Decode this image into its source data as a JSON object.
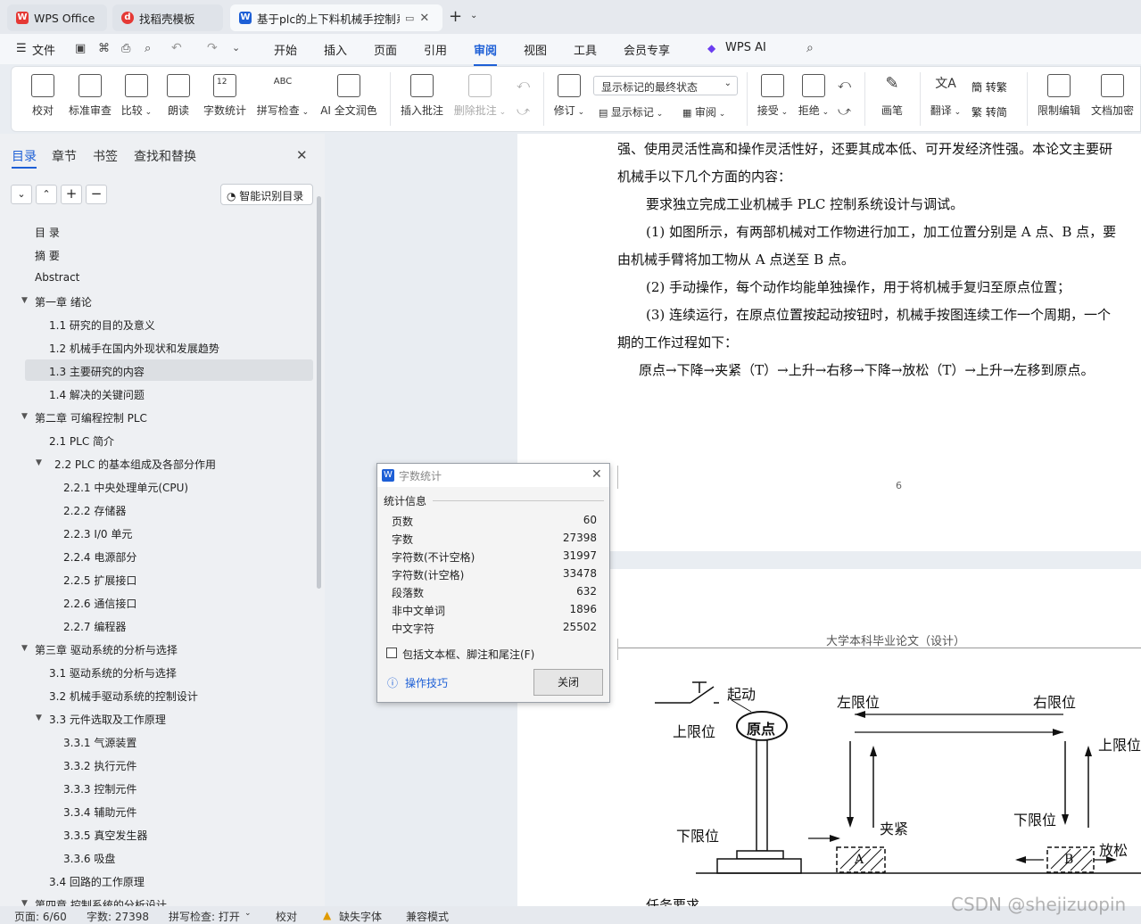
{
  "tabs": [
    {
      "label": "WPS Office"
    },
    {
      "label": "找稻壳模板"
    },
    {
      "label": "基于plc的上下料机械手控制系"
    }
  ],
  "menubar": {
    "file": "文件",
    "items": [
      "开始",
      "插入",
      "页面",
      "引用",
      "审阅",
      "视图",
      "工具",
      "会员专享"
    ],
    "ai": "WPS AI"
  },
  "ribbon": {
    "proofread": "校对",
    "standard_review": "标准审查",
    "compare": "比较",
    "read_aloud": "朗读",
    "word_count": "字数统计",
    "spell_check": "拼写检查",
    "ai_polish": "AI 全文润色",
    "insert_comment": "插入批注",
    "delete_comment": "删除批注",
    "track": "修订",
    "markup_select": "显示标记的最终状态",
    "show_markup": "显示标记",
    "review": "审阅",
    "accept": "接受",
    "reject": "拒绝",
    "pen": "画笔",
    "translate": "翻译",
    "to_trad": "转繁",
    "to_simp": "转简",
    "restrict": "限制编辑",
    "encrypt": "文档加密"
  },
  "sidebar": {
    "tabs": [
      "目录",
      "章节",
      "书签",
      "查找和替换"
    ],
    "smart_toc": "智能识别目录",
    "toc": [
      {
        "label": "目    录"
      },
      {
        "label": "摘    要"
      },
      {
        "label": "Abstract"
      },
      {
        "label": "第一章   绪论"
      },
      {
        "label": "1.1   研究的目的及意义"
      },
      {
        "label": "1.2   机械手在国内外现状和发展趋势"
      },
      {
        "label": "1.3   主要研究的内容"
      },
      {
        "label": "1.4   解决的关键问题"
      },
      {
        "label": "第二章  可编程控制 PLC"
      },
      {
        "label": "2.1 PLC  简介"
      },
      {
        "label": "2.2    PLC 的基本组成及各部分作用"
      },
      {
        "label": "2.2.1 中央处理单元(CPU)"
      },
      {
        "label": "2.2.2 存储器"
      },
      {
        "label": "2.2.3 I/0 单元"
      },
      {
        "label": "2.2.4 电源部分"
      },
      {
        "label": "2.2.5 扩展接口"
      },
      {
        "label": "2.2.6 通信接口"
      },
      {
        "label": "2.2.7 编程器"
      },
      {
        "label": "第三章   驱动系统的分析与选择"
      },
      {
        "label": "3.1   驱动系统的分析与选择"
      },
      {
        "label": "3.2   机械手驱动系统的控制设计"
      },
      {
        "label": "3.3   元件选取及工作原理"
      },
      {
        "label": "3.3.1    气源装置"
      },
      {
        "label": "3.3.2    执行元件"
      },
      {
        "label": "3.3.3    控制元件"
      },
      {
        "label": "3.3.4    辅助元件"
      },
      {
        "label": "3.3.5    真空发生器"
      },
      {
        "label": "3.3.6    吸盘"
      },
      {
        "label": "3.4   回路的工作原理"
      },
      {
        "label": "第四章   控制系统的分析设计"
      }
    ]
  },
  "document": {
    "lines": [
      "强、使用灵活性高和操作灵活性好，还要其成本低、可开发经济性强。本论文主要研",
      "机械手以下几个方面的内容：",
      "要求独立完成工业机械手 PLC 控制系统设计与调试。",
      "(1) 如图所示，有两部机械对工作物进行加工，加工位置分别是 A 点、B 点，要",
      "由机械手臂将加工物从 A 点送至 B 点。",
      "(2) 手动操作，每个动作均能单独操作，用于将机械手复归至原点位置；",
      "(3) 连续运行，在原点位置按起动按钮时，机械手按图连续工作一个周期，一个",
      "期的工作过程如下：",
      "原点→下降→夹紧（T）→上升→右移→下降→放松（T）→上升→左移到原点。"
    ],
    "page_number": "6",
    "header": "大学本科毕业论文（设计）",
    "diagram_labels": {
      "start": "起动",
      "origin": "原点",
      "upper_limit_left": "上限位",
      "lower_limit_left": "下限位",
      "left_limit": "左限位",
      "right_limit": "右限位",
      "clamp": "夹紧",
      "upper_limit_right": "上限位",
      "lower_limit_right": "下限位",
      "release": "放松",
      "a": "A",
      "b": "B"
    },
    "bottom_text": "任务要求"
  },
  "dialog": {
    "title": "字数统计",
    "section": "统计信息",
    "rows": [
      {
        "label": "页数",
        "value": "60"
      },
      {
        "label": "字数",
        "value": "27398"
      },
      {
        "label": "字符数(不计空格)",
        "value": "31997"
      },
      {
        "label": "字符数(计空格)",
        "value": "33478"
      },
      {
        "label": "段落数",
        "value": "632"
      },
      {
        "label": "非中文单词",
        "value": "1896"
      },
      {
        "label": "中文字符",
        "value": "25502"
      }
    ],
    "checkbox": "包括文本框、脚注和尾注(F)",
    "tips": "操作技巧",
    "close": "关闭"
  },
  "status": {
    "page": "页面: 6/60",
    "words": "字数: 27398",
    "spell": "拼写检查: 打开",
    "proof": "校对",
    "missing_font": "缺失字体",
    "compat": "兼容模式"
  },
  "watermark": "CSDN @shejizuopin"
}
